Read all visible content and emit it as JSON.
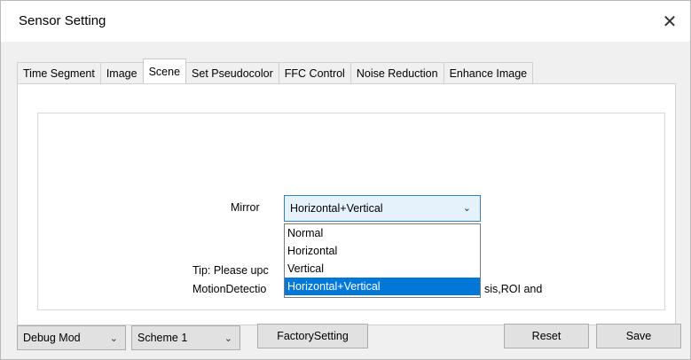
{
  "window": {
    "title": "Sensor Setting",
    "close_glyph": "✕"
  },
  "tabs": [
    {
      "label": "Time Segment",
      "active": false
    },
    {
      "label": "Image",
      "active": false
    },
    {
      "label": "Scene",
      "active": true
    },
    {
      "label": "Set Pseudocolor",
      "active": false
    },
    {
      "label": "FFC Control",
      "active": false
    },
    {
      "label": "Noise Reduction",
      "active": false
    },
    {
      "label": "Enhance Image",
      "active": false
    }
  ],
  "scene": {
    "mirror_label": "Mirror",
    "mirror_value": "Horizontal+Vertical",
    "mirror_options": [
      "Normal",
      "Horizontal",
      "Vertical",
      "Horizontal+Vertical"
    ],
    "tip_line1": "Tip: Please upc",
    "tip_line2_start": "MotionDetectio",
    "tip_line2_end": "sis,ROI and"
  },
  "bottom": {
    "debug_mode": "Debug Mod",
    "scheme": "Scheme 1",
    "factory_setting": "FactorySetting",
    "reset": "Reset",
    "save": "Save"
  },
  "icons": {
    "chevron": "chevron-down-icon",
    "close": "close-icon"
  }
}
